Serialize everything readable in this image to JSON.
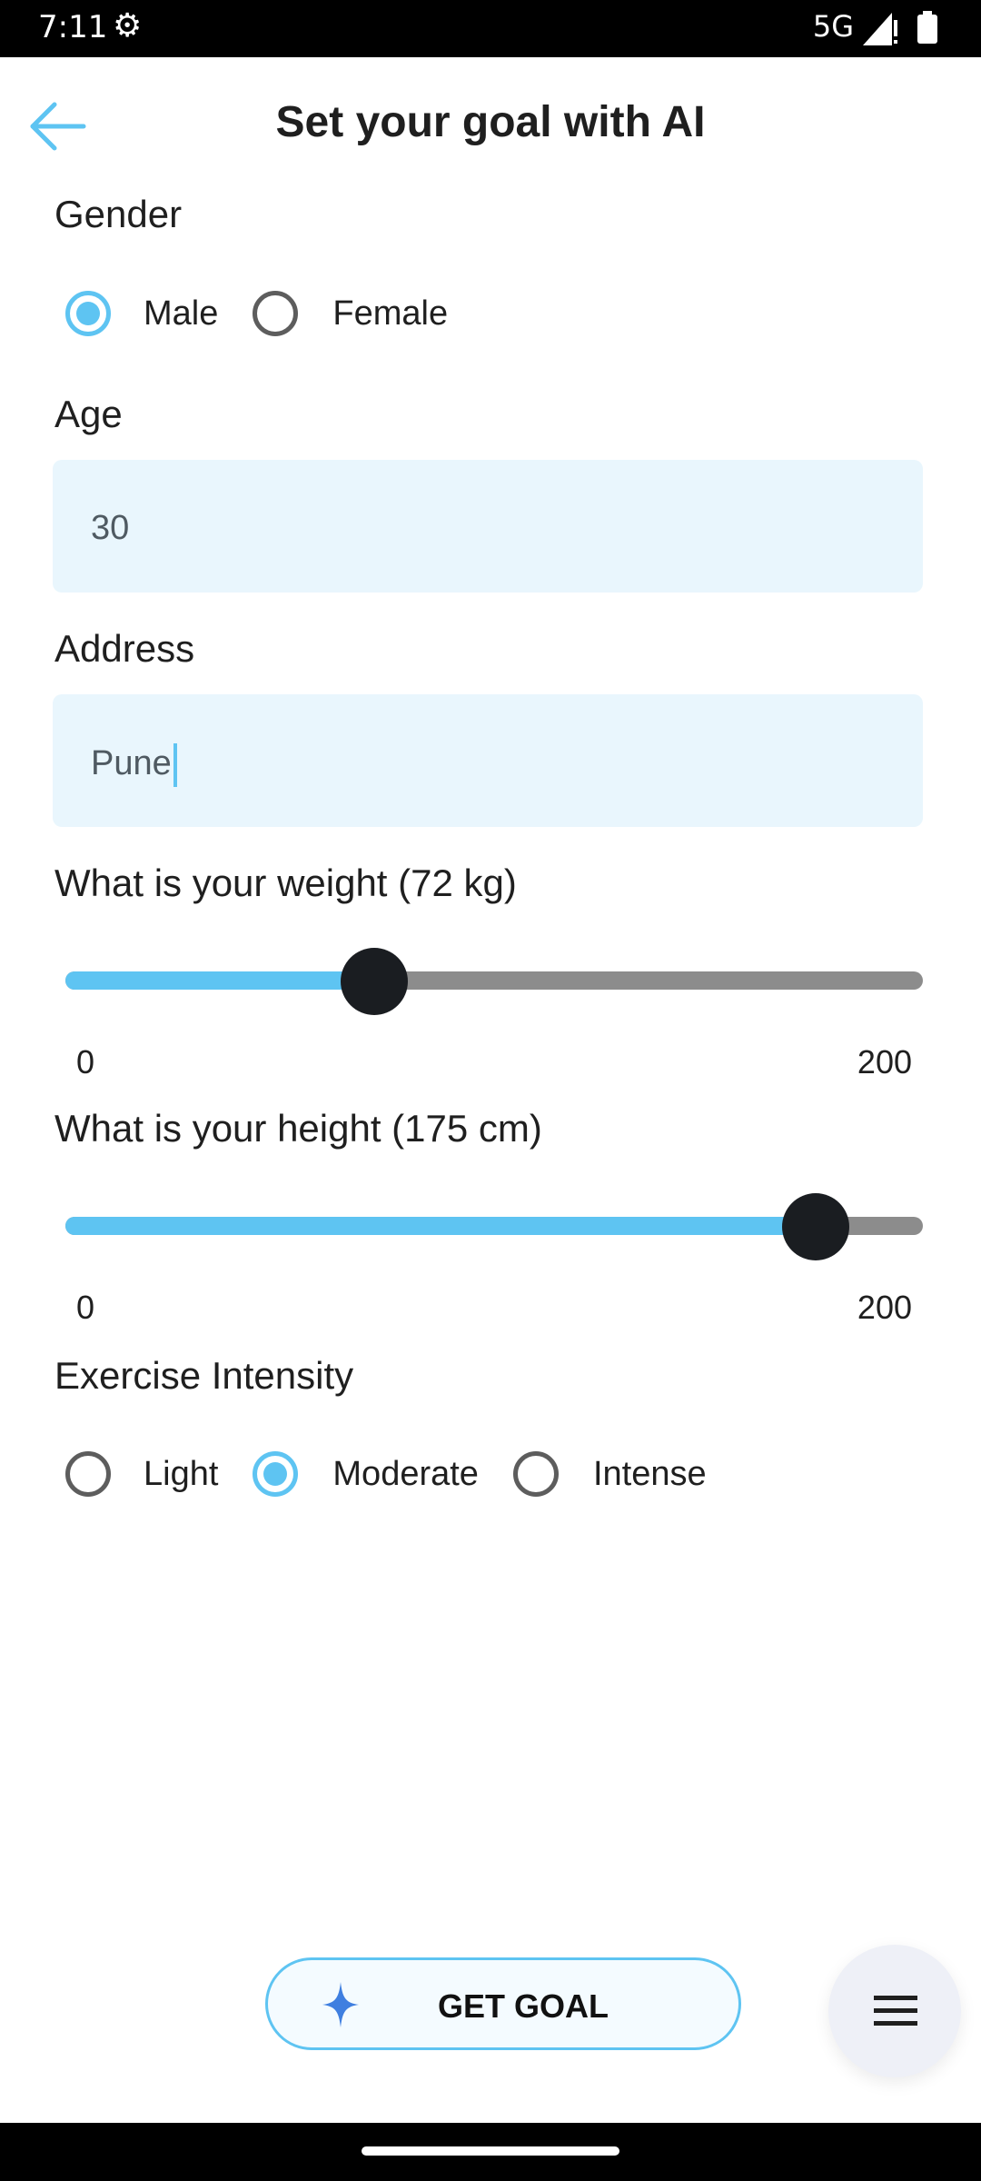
{
  "status": {
    "time": "7:11",
    "network": "5G"
  },
  "header": {
    "title": "Set your goal with AI"
  },
  "gender": {
    "label": "Gender",
    "options": [
      "Male",
      "Female"
    ],
    "selected": "Male"
  },
  "age": {
    "label": "Age",
    "value": "30"
  },
  "address": {
    "label": "Address",
    "value": "Pune"
  },
  "weight": {
    "label": "What is your weight (72 kg)",
    "value": 72,
    "min_label": "0",
    "max_label": "200",
    "min": 0,
    "max": 200
  },
  "height": {
    "label": "What is your height (175 cm)",
    "value": 175,
    "min_label": "0",
    "max_label": "200",
    "min": 0,
    "max": 200
  },
  "intensity": {
    "label": "Exercise Intensity",
    "options": [
      "Light",
      "Moderate",
      "Intense"
    ],
    "selected": "Moderate"
  },
  "actions": {
    "get_goal": "GET GOAL"
  },
  "icons": {
    "back": "back-arrow-icon",
    "spark": "sparkle-icon",
    "menu": "menu-icon",
    "settings": "gear-icon"
  },
  "colors": {
    "accent": "#5ec4f2",
    "field_bg": "#e9f6fd",
    "thumb": "#1a1d21",
    "track": "#8c8c8c"
  }
}
